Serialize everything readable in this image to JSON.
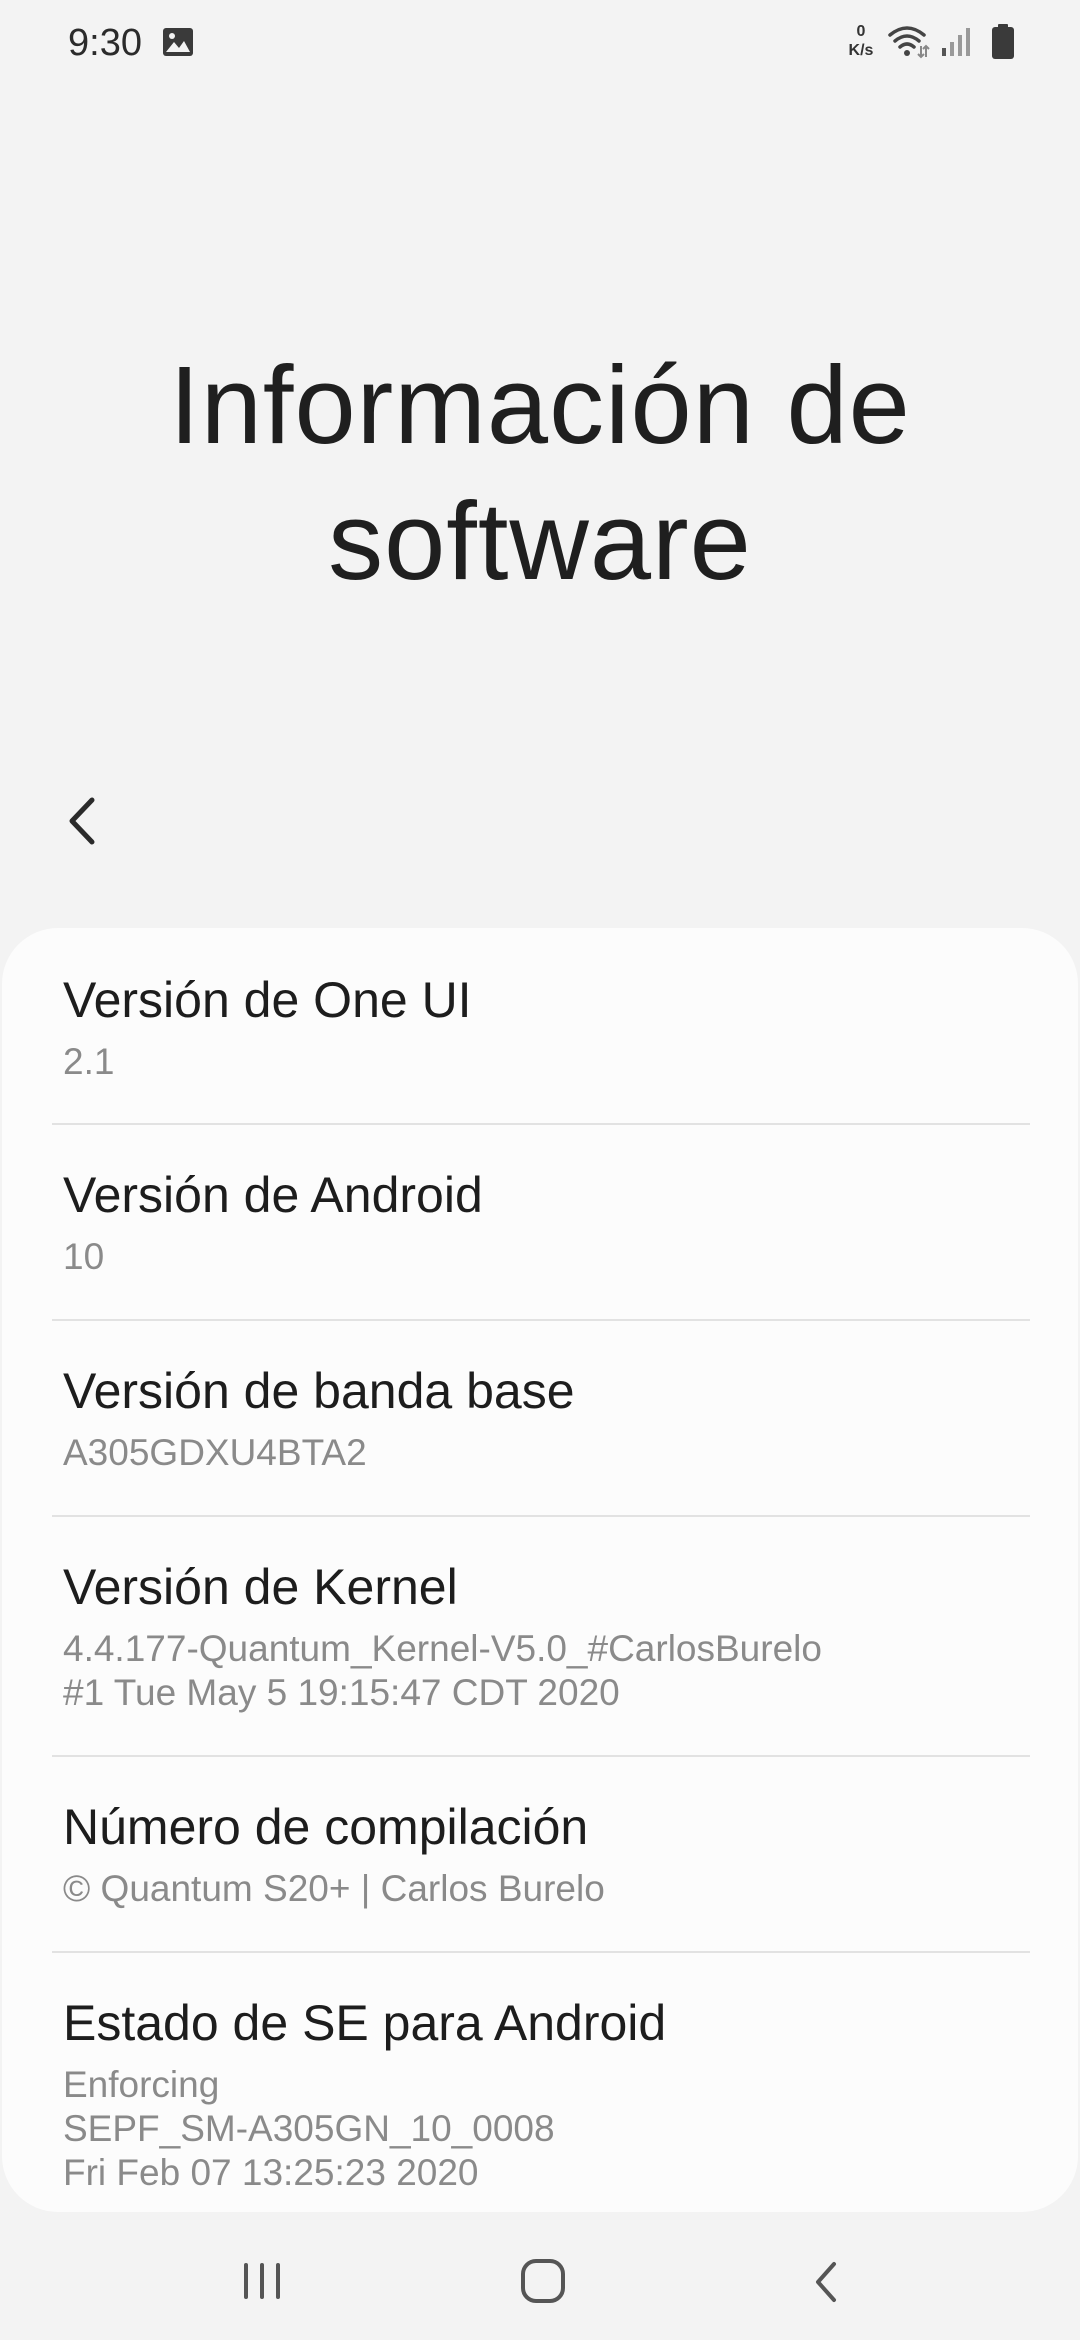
{
  "status_bar": {
    "time": "9:30",
    "net_speed_value": "0",
    "net_speed_unit": "K/s"
  },
  "header": {
    "title_line1": "Información de",
    "title_line2": "software"
  },
  "items": [
    {
      "title": "Versión de One UI",
      "value": "2.1"
    },
    {
      "title": "Versión de Android",
      "value": "10"
    },
    {
      "title": "Versión de banda base",
      "value": "A305GDXU4BTA2"
    },
    {
      "title": "Versión de Kernel",
      "value": "4.4.177-Quantum_Kernel-V5.0_#CarlosBurelo\n#1 Tue May 5 19:15:47 CDT 2020"
    },
    {
      "title": "Número de compilación",
      "value": "© Quantum S20+ | Carlos Burelo"
    },
    {
      "title": "Estado de SE para Android",
      "value": "Enforcing\nSEPF_SM-A305GN_10_0008\nFri Feb 07 13:25:23 2020"
    }
  ],
  "icons": {
    "gallery": "image-icon",
    "wifi": "wifi-icon",
    "signal": "signal-icon",
    "battery": "battery-icon",
    "back": "chevron-left-icon",
    "nav_recents": "recents-icon",
    "nav_home": "home-icon",
    "nav_back": "back-icon"
  },
  "colors": {
    "background": "#f3f3f3",
    "card": "#fcfcfc",
    "title_text": "#1d1d1d",
    "secondary_text": "#8a8a8a",
    "divider": "#e2e2e2"
  }
}
